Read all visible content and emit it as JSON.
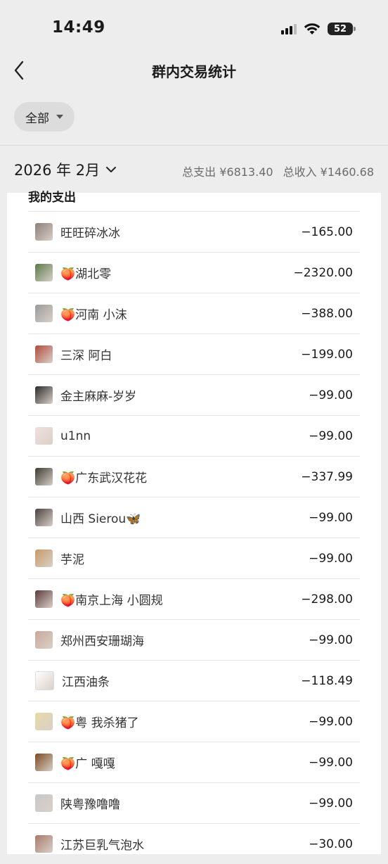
{
  "status": {
    "time": "14:49",
    "battery": "52"
  },
  "nav": {
    "title": "群内交易统计"
  },
  "filter": {
    "label": "全部"
  },
  "month": {
    "label": "2026 年 2月"
  },
  "summary": {
    "expense": "总支出 ¥6813.40",
    "income": "总收入 ¥1460.68"
  },
  "section": {
    "title": "我的支出"
  },
  "rows": [
    {
      "name": "旺旺碎冰冰",
      "amount": "−165.00",
      "avatar": "#8c7e78"
    },
    {
      "name": "🍑湖北零",
      "amount": "−2320.00",
      "avatar": "#5a7a4a"
    },
    {
      "name": "🍑河南 小沫",
      "amount": "−388.00",
      "avatar": "#9a9a9a"
    },
    {
      "name": "三深 阿白",
      "amount": "−199.00",
      "avatar": "#b04a3a"
    },
    {
      "name": "金主麻麻-岁岁",
      "amount": "−99.00",
      "avatar": "#2a2a2a"
    },
    {
      "name": "u1nn",
      "amount": "−99.00",
      "avatar": "#f1dede"
    },
    {
      "name": "🍑广东武汉花花",
      "amount": "−337.99",
      "avatar": "#3a3a30"
    },
    {
      "name": "山西 Sierou🦋",
      "amount": "−99.00",
      "avatar": "#4a4040"
    },
    {
      "name": "芋泥",
      "amount": "−99.00",
      "avatar": "#c89a6a"
    },
    {
      "name": "🍑南京上海 小圆规",
      "amount": "−298.00",
      "avatar": "#5a3a3a"
    },
    {
      "name": "郑州西安珊瑚海",
      "amount": "−99.00",
      "avatar": "#c8a89a"
    },
    {
      "name": "江西油条",
      "amount": "−118.49",
      "avatar": "#ffffff"
    },
    {
      "name": "🍑粤 我杀猪了",
      "amount": "−99.00",
      "avatar": "#e8d8a8"
    },
    {
      "name": "🍑广  嘎嘎",
      "amount": "−99.00",
      "avatar": "#7a4a20"
    },
    {
      "name": "陕粤豫噜噜",
      "amount": "−99.00",
      "avatar": "#c8c8c8"
    },
    {
      "name": "江苏巨乳气泡水",
      "amount": "−30.00",
      "avatar": "#a87a6a"
    }
  ]
}
